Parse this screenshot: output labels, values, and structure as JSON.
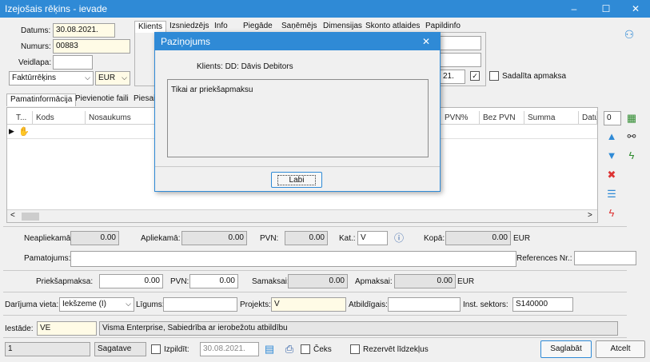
{
  "window": {
    "title": "Izejošais rēķins - ievade",
    "minimize": "–",
    "maximize": "☐",
    "close": "✕"
  },
  "header": {
    "datums_label": "Datums:",
    "datums_value": "30.08.2021.",
    "numurs_label": "Numurs:",
    "numurs_value": "00883",
    "veidlapa_label": "Veidlapa:",
    "veidlapa_value": "",
    "doc_type": "Faktūrrēķins",
    "currency": "EUR",
    "date_field": "21.",
    "sadalita_label": "Sadalīta apmaksa",
    "top_tabs": [
      "Klients",
      "Izsniedzējs",
      "Info",
      "Piegāde",
      "Saņēmējs",
      "Dimensijas",
      "Skonto atlaides",
      "Papildinfo"
    ]
  },
  "main_tabs": [
    "Pamatinformācija",
    "Pievienotie faili",
    "Piesai"
  ],
  "grid": {
    "columns": [
      "T...",
      "Kods",
      "Nosaukums",
      "PVN%",
      "Bez PVN",
      "Summa",
      "Datu"
    ],
    "counter": "0"
  },
  "dialog": {
    "title": "Paziņojums",
    "close": "✕",
    "client_line": "Klients:  DD: Dāvis Debitors",
    "message": "Tikai ar priekšapmaksu",
    "ok_label": "Labi"
  },
  "totals": {
    "neapliekama_label": "Neapliekamā:",
    "neapliekama_value": "0.00",
    "apliekama_label": "Apliekamā:",
    "apliekama_value": "0.00",
    "pvn_label": "PVN:",
    "pvn_value": "0.00",
    "kat_label": "Kat.:",
    "kat_value": "V",
    "kopa_label": "Kopā:",
    "kopa_value": "0.00",
    "kopa_currency": "EUR"
  },
  "pamatojums_label": "Pamatojums:",
  "references_label": "References Nr.:",
  "prepay": {
    "priekssapmaksa_label": "Priekšapmaksa:",
    "priekssapmaksa_value": "0.00",
    "pvn_label": "PVN:",
    "pvn_value": "0.00",
    "samaksai_label": "Samaksai:",
    "samaksai_value": "0.00",
    "apmaksai_label": "Apmaksai:",
    "apmaksai_value": "0.00",
    "currency": "EUR"
  },
  "deal": {
    "vieta_label": "Darījuma vieta:",
    "vieta_value": "Iekšzeme (I)",
    "ligums_label": "Līgums:",
    "projekts_label": "Projekts:",
    "projekts_value": "V",
    "atbildigais_label": "Atbildīgais:",
    "sektors_label": "Inst. sektors:",
    "sektors_value": "S140000"
  },
  "iestade": {
    "label": "Iestāde:",
    "code": "VE",
    "name": "Visma Enterprise, Sabiedrība ar ierobežotu atbildību"
  },
  "footer": {
    "number": "1",
    "status": "Sagatave",
    "izpildit_label": "Izpildīt:",
    "izpildit_date": "30.08.2021.",
    "ceks_label": "Čeks",
    "rezervet_label": "Rezervēt līdzekļus",
    "save_label": "Saglabāt",
    "cancel_label": "Atcelt"
  }
}
